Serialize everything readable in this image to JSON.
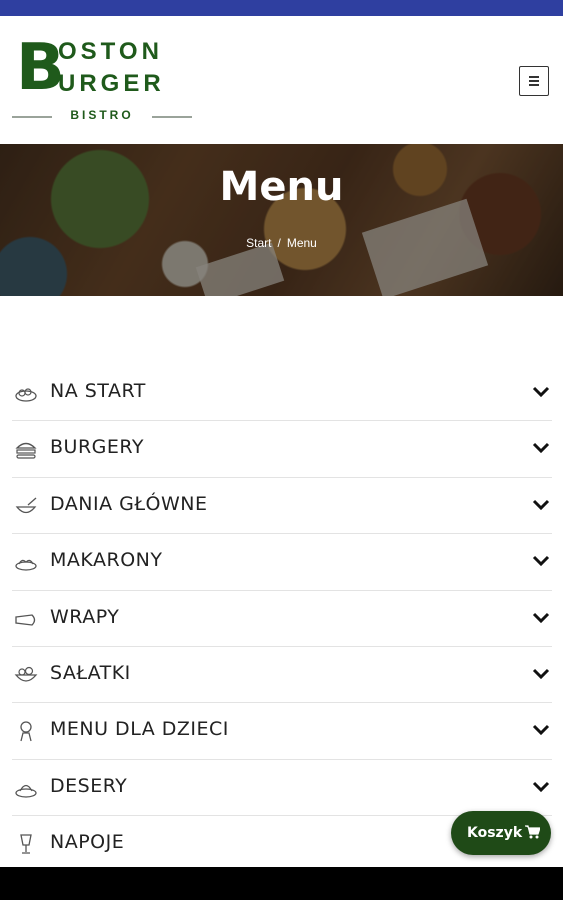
{
  "logo": {
    "line1": "OSTON",
    "line2": "URGER",
    "big_letter": "B",
    "subtitle": "BISTRO"
  },
  "hero": {
    "title": "Menu",
    "breadcrumb": [
      "Start",
      "Menu"
    ],
    "breadcrumb_separator": "/"
  },
  "menu": {
    "items": [
      {
        "label": "NA START",
        "icon": "appetizer-icon"
      },
      {
        "label": "BURGERY",
        "icon": "burger-icon"
      },
      {
        "label": "DANIA GŁÓWNE",
        "icon": "main-dish-icon"
      },
      {
        "label": "MAKARONY",
        "icon": "pasta-icon"
      },
      {
        "label": "WRAPY",
        "icon": "wrap-icon"
      },
      {
        "label": "SAŁATKI",
        "icon": "salad-icon"
      },
      {
        "label": "MENU DLA DZIECI",
        "icon": "kids-menu-icon"
      },
      {
        "label": "DESERY",
        "icon": "dessert-icon"
      },
      {
        "label": "NAPOJE",
        "icon": "drink-icon"
      }
    ]
  },
  "cart": {
    "label": "Koszyk",
    "icon": "cart-icon"
  },
  "colors": {
    "brand_green": "#1f5a1b",
    "cart_button": "#1f4a17",
    "status_bar": "#2f3fa0"
  }
}
